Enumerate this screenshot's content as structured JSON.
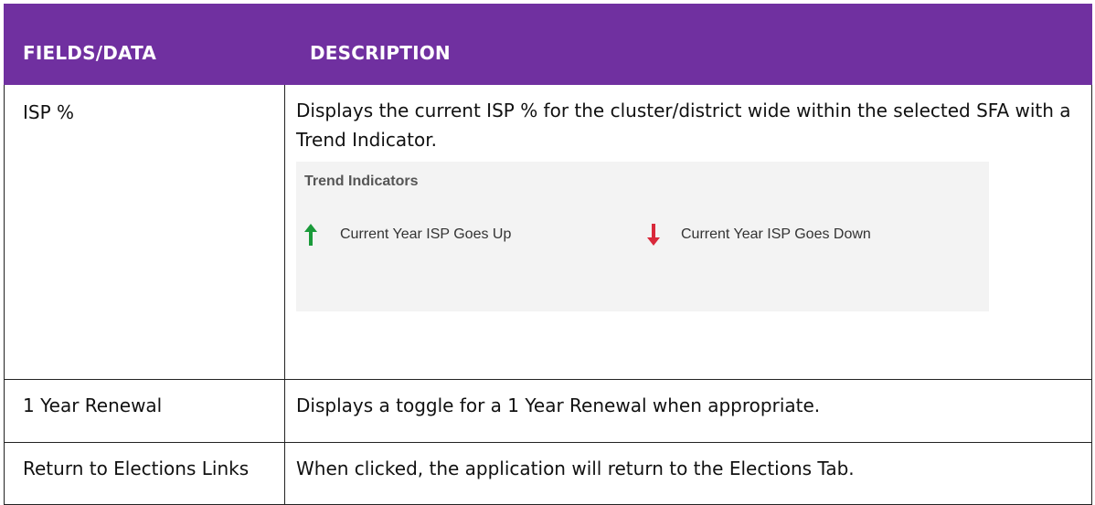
{
  "table": {
    "headers": [
      "FIELDS/DATA",
      "DESCRIPTION"
    ],
    "rows": [
      {
        "field": "ISP %",
        "description": "Displays the current ISP % for the cluster/district wide within the selected SFA with a Trend Indicator."
      },
      {
        "field": "1 Year Renewal",
        "description": "Displays a toggle for a 1 Year Renewal when appropriate."
      },
      {
        "field": "Return to Elections Links",
        "description": "When clicked, the application will return to the Elections Tab."
      }
    ]
  },
  "trend_indicators": {
    "title": "Trend Indicators",
    "up": {
      "label": "Current Year ISP Goes Up",
      "icon": "arrow-up-icon",
      "color": "#1a9a3a"
    },
    "down": {
      "label": "Current Year ISP Goes Down",
      "icon": "arrow-down-icon",
      "color": "#d9283a"
    }
  },
  "colors": {
    "header_bg": "#7030a0",
    "header_text": "#ffffff",
    "indicator_box_bg": "#f3f3f3"
  }
}
